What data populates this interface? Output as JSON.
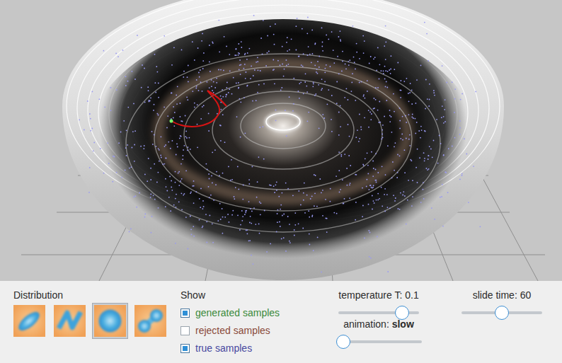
{
  "distribution": {
    "label": "Distribution",
    "options": [
      {
        "selected": false
      },
      {
        "selected": false
      },
      {
        "selected": true
      },
      {
        "selected": false
      }
    ]
  },
  "show": {
    "label": "Show",
    "options": [
      {
        "label": "generated samples",
        "checked": true,
        "color": "#3b8a3b"
      },
      {
        "label": "rejected samples",
        "checked": false,
        "color": "#8a4a3a"
      },
      {
        "label": "true samples",
        "checked": true,
        "color": "#4848a0"
      }
    ]
  },
  "temperature": {
    "label": "temperature T: 0.1",
    "level": 0.85
  },
  "animation": {
    "label": "animation:",
    "value": "slow",
    "level": 0
  },
  "slide_time": {
    "label": "slide time: 60",
    "level": 0.5
  }
}
